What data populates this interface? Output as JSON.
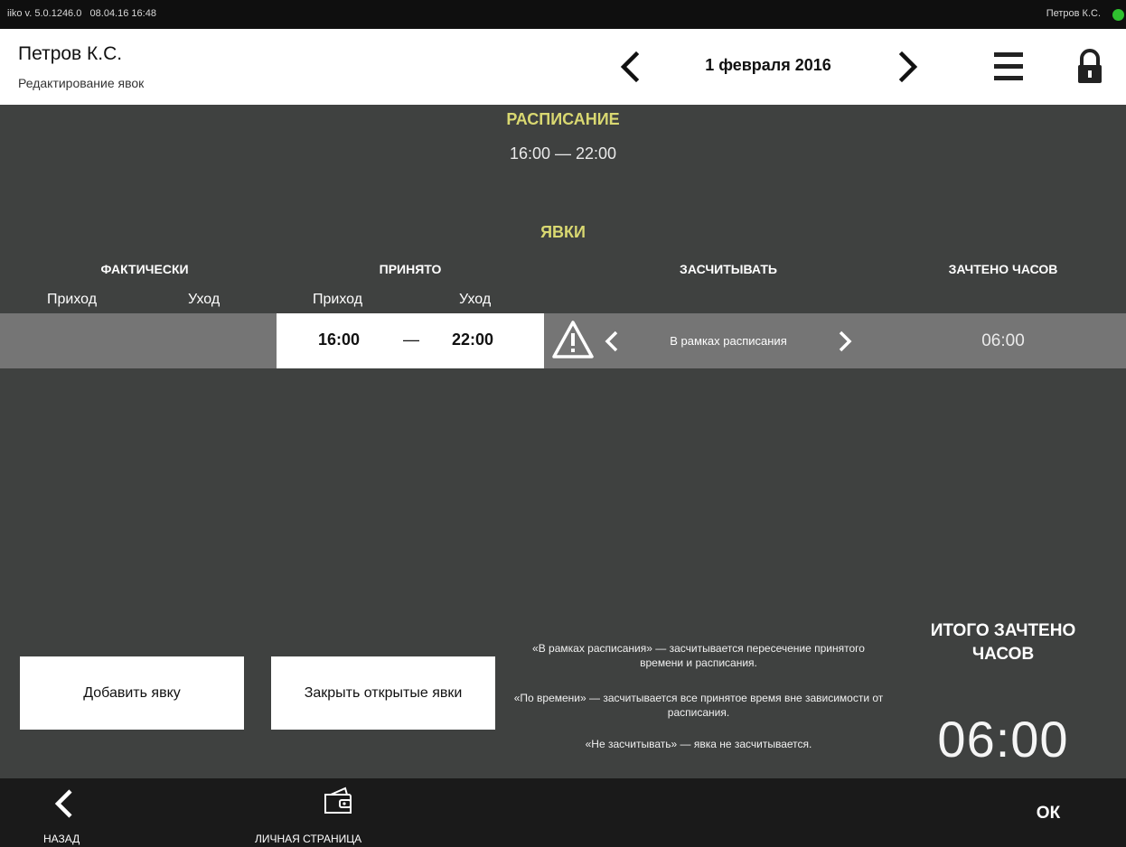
{
  "statusbar": {
    "version": "iiko v. 5.0.1246.0",
    "datetime": "08.04.16  16:48",
    "user": "Петров К.С."
  },
  "header": {
    "name": "Петров К.С.",
    "subtitle": "Редактирование явок",
    "date": "1 февраля 2016"
  },
  "schedule": {
    "title": "РАСПИСАНИЕ",
    "time": "16:00 — 22:00"
  },
  "attendance": {
    "title": "ЯВКИ",
    "columns": {
      "actual": "ФАКТИЧЕСКИ",
      "accepted": "ПРИНЯТО",
      "count_as": "ЗАСЧИТЫВАТЬ",
      "counted_hours": "ЗАЧТЕНО ЧАСОВ"
    },
    "sub": {
      "arrival": "Приход",
      "departure": "Уход"
    },
    "rows": [
      {
        "accepted_in": "16:00",
        "sep": "—",
        "accepted_out": "22:00",
        "mode": "В рамках расписания",
        "hours": "06:00"
      }
    ]
  },
  "buttons": {
    "add": "Добавить явку",
    "close_open": "Закрыть открытые явки"
  },
  "legend": [
    "«В рамках расписания» — засчитывается пересечение принятого времени и расписания.",
    "«По времени» — засчитывается все принятое время вне зависимости от расписания.",
    "«Не засчитывать» — явка не засчитывается."
  ],
  "total": {
    "title": "ИТОГО ЗАЧТЕНО ЧАСОВ",
    "value": "06:00"
  },
  "footer": {
    "back": "НАЗАД",
    "personal": "ЛИЧНАЯ СТРАНИЦА",
    "ok": "ОК"
  },
  "colors": {
    "accent": "#d9d871",
    "background": "#3f4140",
    "row": "#757575",
    "status_ok": "#2fc12f"
  }
}
